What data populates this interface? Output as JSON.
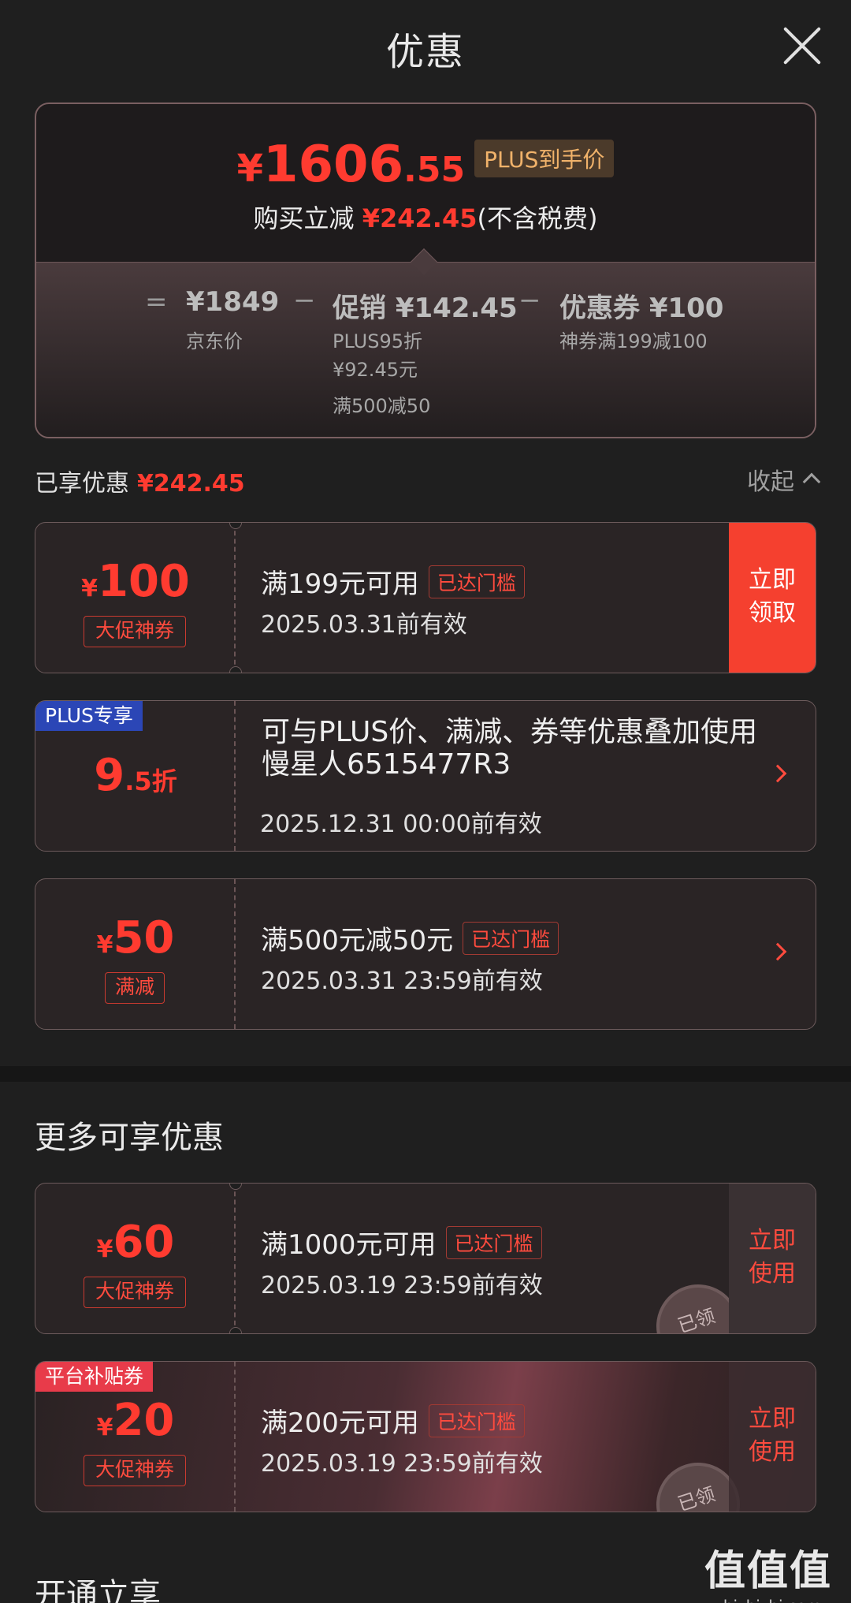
{
  "header": {
    "title": "优惠"
  },
  "summary": {
    "yen": "¥",
    "price_int": "1606",
    "price_dec": ".55",
    "tag": "PLUS到手价",
    "save_prefix": "购买立减",
    "save_amount": "¥242.45",
    "save_suffix": "(不含税费)",
    "eq": "=",
    "minus": "−",
    "jd_price": "¥1849",
    "jd_label": "京东价",
    "promo_title": "促销 ¥142.45",
    "promo_sub1": "PLUS95折",
    "promo_sub2": "¥92.45元",
    "promo_sub3": "满500减50",
    "coupon_title": "优惠券 ¥100",
    "coupon_sub": "神券满199减100"
  },
  "enjoyed": {
    "label": "已享优惠",
    "amount": "¥242.45",
    "collapse": "收起"
  },
  "coupons": [
    {
      "yen": "¥",
      "amount": "100",
      "label": "大促神券",
      "line1": "满199元可用",
      "badge": "已达门槛",
      "line2": "2025.03.31前有效",
      "action": "立即\n领取"
    },
    {
      "corner": "PLUS专享",
      "amount_big": "9",
      "amount_small": ".5折",
      "line1": "可与PLUS价、满减、券等优惠叠加使用",
      "overlay": "慢星人6515477R3",
      "line2": "2025.12.31 00:00前有效"
    },
    {
      "yen": "¥",
      "amount": "50",
      "label": "满减",
      "line1": "满500元减50元",
      "badge": "已达门槛",
      "line2": "2025.03.31 23:59前有效"
    }
  ],
  "more": {
    "title": "更多可享优惠"
  },
  "more_coupons": [
    {
      "yen": "¥",
      "amount": "60",
      "label": "大促神券",
      "line1": "满1000元可用",
      "badge": "已达门槛",
      "line2": "2025.03.19 23:59前有效",
      "action": "立即\n使用",
      "stamp": "已领"
    },
    {
      "corner": "平台补贴券",
      "yen": "¥",
      "amount": "20",
      "label": "大促神券",
      "line1": "满200元可用",
      "badge": "已达门槛",
      "line2": "2025.03.19 23:59前有效",
      "action": "立即\n使用",
      "stamp": "已领"
    }
  ],
  "bottom": {
    "title": "开通立享"
  },
  "watermark": {
    "text": "值值值",
    "url": "zhizhizhi.com"
  },
  "colors": {
    "accent": "#ff3b30",
    "plus_badge": "#2b46b6",
    "subsidy_badge": "#e83b4a"
  }
}
